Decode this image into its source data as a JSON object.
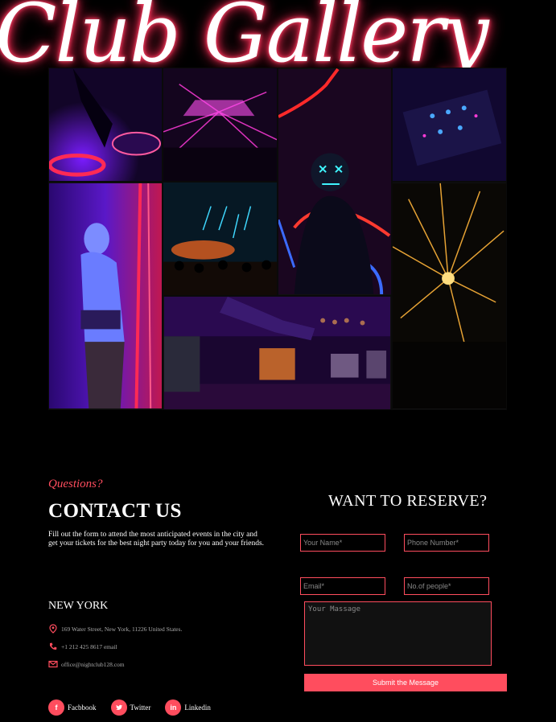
{
  "header": {
    "title": "Club Gallery"
  },
  "gallery": {
    "images": [
      {
        "name": "dj-turntable-image"
      },
      {
        "name": "laser-stage-image"
      },
      {
        "name": "neon-mask-man-image"
      },
      {
        "name": "dj-mixer-image"
      },
      {
        "name": "dancing-woman-image"
      },
      {
        "name": "crowd-blue-lights-image"
      },
      {
        "name": "bartender-cocktail-image"
      },
      {
        "name": "golden-lasers-image"
      }
    ]
  },
  "contact": {
    "eyebrow": "Questions?",
    "title": "CONTACT US",
    "description": "Fill out the form to attend the most anticipated events in the city and get your tickets for the best night party today for you and your friends.",
    "city": "NEW YORK",
    "address": "169 Water Street, New York, 11226 United States.",
    "phone": "+1 212 425 8617 email",
    "email": "office@nightclub128.com",
    "socials": [
      {
        "label": "Facbbook",
        "icon": "f"
      },
      {
        "label": "Twitter",
        "icon": "t"
      },
      {
        "label": "Linkedin",
        "icon": "in"
      }
    ]
  },
  "reserve": {
    "title": "WANT TO RESERVE?",
    "name_placeholder": "Your Name*",
    "phone_placeholder": "Phone Number*",
    "email_placeholder": "Email*",
    "people_placeholder": "No.of people*",
    "message_placeholder": "Your Massage",
    "submit_label": "Submit the Message"
  },
  "colors": {
    "accent": "#ff4d5e",
    "background": "#000000"
  }
}
